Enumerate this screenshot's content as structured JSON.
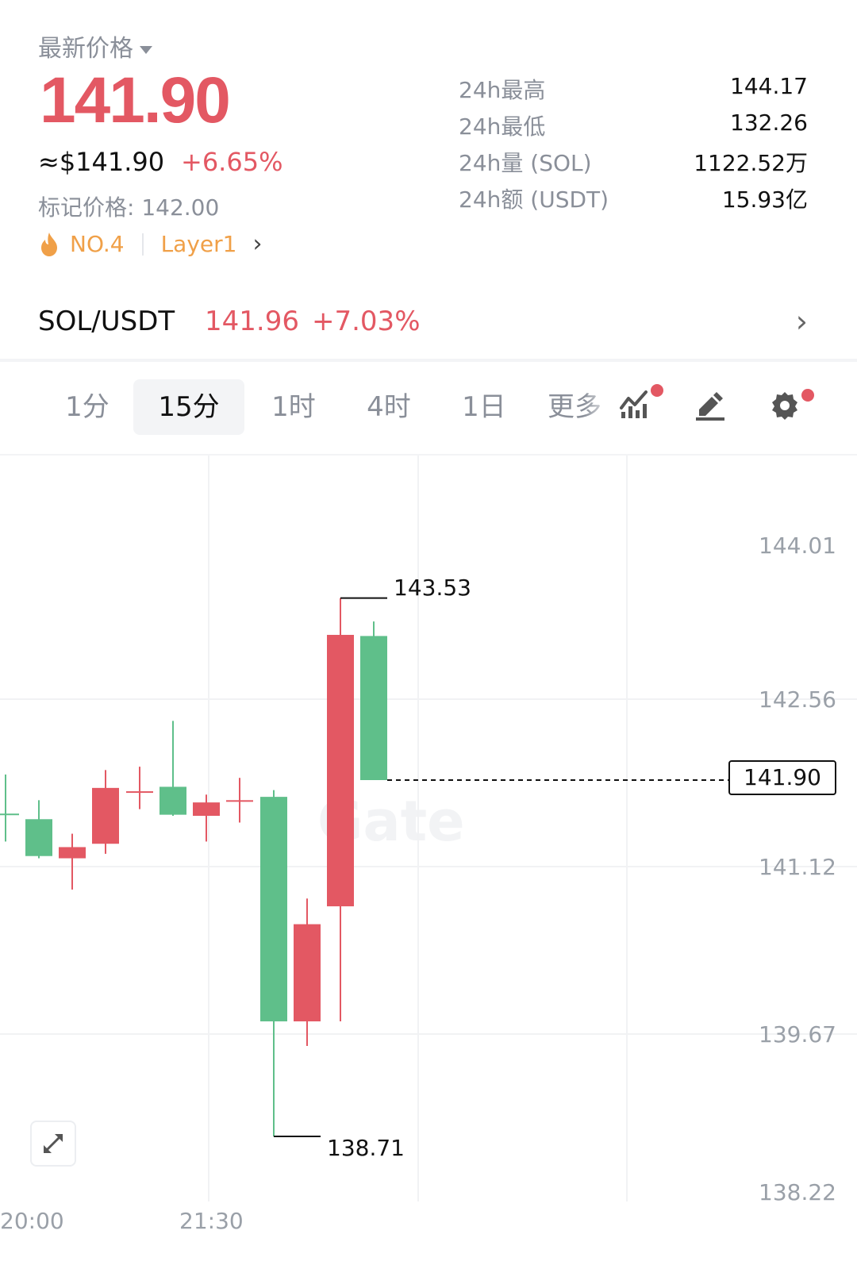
{
  "header": {
    "latest_label": "最新价格",
    "price": "141.90",
    "usd_price": "≈$141.90",
    "change_pct": "+6.65%",
    "mark_price": "标记价格: 142.00",
    "rank": "NO.4",
    "category": "Layer1"
  },
  "stats": [
    {
      "label": "24h最高",
      "value": "144.17"
    },
    {
      "label": "24h最低",
      "value": "132.26"
    },
    {
      "label": "24h量 (SOL)",
      "value": "1122.52万"
    },
    {
      "label": "24h额 (USDT)",
      "value": "15.93亿"
    }
  ],
  "pair": {
    "name": "SOL/USDT",
    "price": "141.96",
    "change": "+7.03%"
  },
  "tabs": [
    "1分",
    "15分",
    "1时",
    "4时",
    "1日",
    "更多"
  ],
  "active_tab": "15分",
  "icons": [
    "fire-icon",
    "chevron-right-icon",
    "indicator-icon",
    "draw-icon",
    "settings-icon",
    "expand-icon"
  ],
  "colors": {
    "up": "#e35863",
    "down": "#5fbf8a",
    "accent": "#e35863",
    "tag": "#f0a048"
  },
  "chart_data": {
    "type": "candlestick",
    "y_ticks": [
      "144.01",
      "142.56",
      "141.12",
      "139.67",
      "138.22"
    ],
    "x_ticks": [
      "20:00",
      "21:30"
    ],
    "current_price": "141.90",
    "high_marker": "143.53",
    "low_marker": "138.71",
    "watermark": "Gate",
    "ylim": [
      138.22,
      144.01
    ],
    "candles": [
      {
        "open": 141.6,
        "close": 141.6,
        "high": 141.95,
        "low": 141.35,
        "dir": "down"
      },
      {
        "open": 141.55,
        "close": 141.22,
        "high": 141.72,
        "low": 141.2,
        "dir": "down"
      },
      {
        "open": 141.2,
        "close": 141.3,
        "high": 141.42,
        "low": 140.92,
        "dir": "up"
      },
      {
        "open": 141.33,
        "close": 141.83,
        "high": 141.99,
        "low": 141.24,
        "dir": "up"
      },
      {
        "open": 141.8,
        "close": 141.8,
        "high": 142.02,
        "low": 141.64,
        "dir": "up"
      },
      {
        "open": 141.84,
        "close": 141.59,
        "high": 142.43,
        "low": 141.58,
        "dir": "down"
      },
      {
        "open": 141.58,
        "close": 141.7,
        "high": 141.77,
        "low": 141.35,
        "dir": "up"
      },
      {
        "open": 141.72,
        "close": 141.72,
        "high": 141.92,
        "low": 141.52,
        "dir": "up"
      },
      {
        "open": 141.75,
        "close": 139.74,
        "high": 141.81,
        "low": 138.71,
        "dir": "down"
      },
      {
        "open": 139.74,
        "close": 140.61,
        "high": 140.84,
        "low": 139.52,
        "dir": "up"
      },
      {
        "open": 140.77,
        "close": 143.2,
        "high": 143.53,
        "low": 139.74,
        "dir": "up"
      },
      {
        "open": 143.19,
        "close": 141.9,
        "high": 143.32,
        "low": 141.9,
        "dir": "down"
      }
    ]
  }
}
